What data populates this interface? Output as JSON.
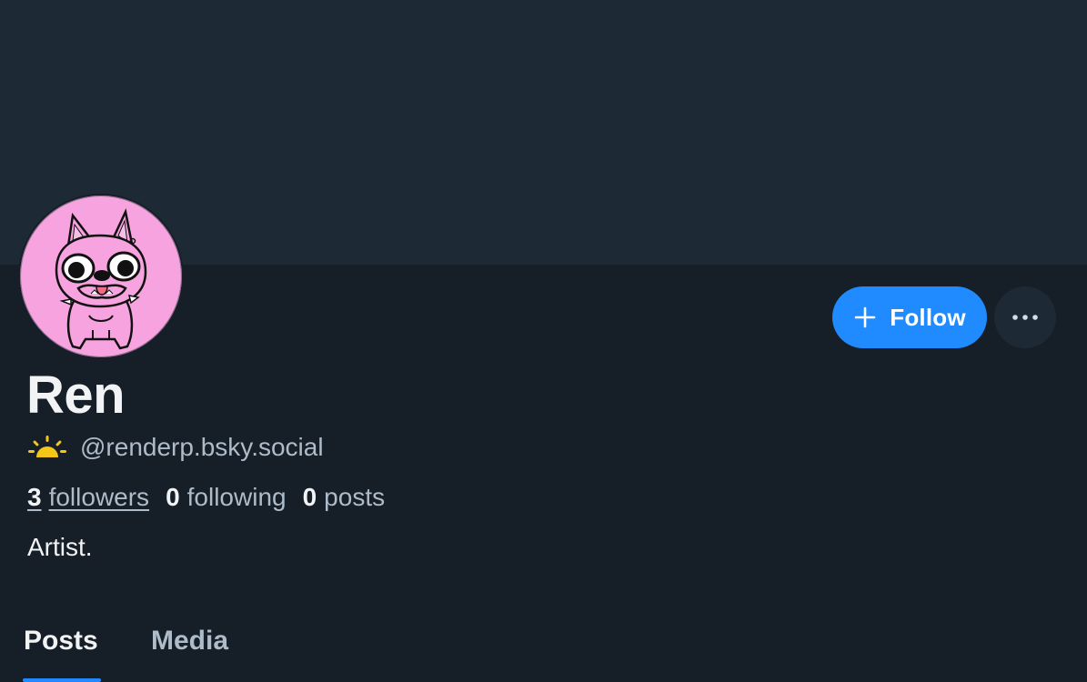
{
  "profile": {
    "display_name": "Ren",
    "handle": "@renderp.bsky.social",
    "bio": "Artist.",
    "avatar_icon": "bulldog-avatar",
    "badge_icon": "sunrise-icon"
  },
  "actions": {
    "follow_label": "Follow",
    "more_icon": "ellipsis-icon"
  },
  "stats": {
    "followers_count": "3",
    "followers_label": "followers",
    "following_count": "0",
    "following_label": "following",
    "posts_count": "0",
    "posts_label": "posts"
  },
  "tabs": [
    {
      "label": "Posts",
      "active": true
    },
    {
      "label": "Media",
      "active": false
    }
  ],
  "colors": {
    "accent": "#208bfe",
    "background": "#161e27",
    "banner": "#1e2936",
    "avatar_bg": "#f7a3df",
    "sun": "#f5c518"
  }
}
